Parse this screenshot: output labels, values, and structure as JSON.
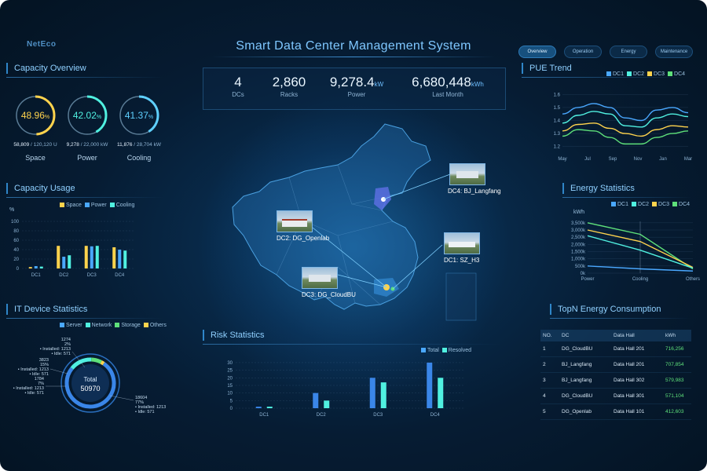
{
  "header": {
    "logo": "NetEco",
    "title": "Smart Data Center Management System",
    "tabs": [
      {
        "label": "Overview",
        "active": true
      },
      {
        "label": "Operation",
        "active": false
      },
      {
        "label": "Energy",
        "active": false
      },
      {
        "label": "Maintenance",
        "active": false
      }
    ]
  },
  "summary": [
    {
      "value": "4",
      "unit": "",
      "label": "DCs"
    },
    {
      "value": "2,860",
      "unit": "",
      "label": "Racks"
    },
    {
      "value": "9,278.4",
      "unit": "kW",
      "label": "Power"
    },
    {
      "value": "6,680,448",
      "unit": "kWh",
      "label": "Last Month"
    }
  ],
  "capacity_overview": {
    "title": "Capacity Overview",
    "gauges": [
      {
        "value": "48.96",
        "unit": "%",
        "used": "58,809",
        "total": "/ 120,120",
        "unit_text": "U",
        "label": "Space",
        "fraction": 0.4896,
        "color": "#ffd34d"
      },
      {
        "value": "42.02",
        "unit": "%",
        "used": "9,278",
        "total": "/ 22,000",
        "unit_text": "kW",
        "label": "Power",
        "fraction": 0.4202,
        "color": "#50f0e0"
      },
      {
        "value": "41.37",
        "unit": "%",
        "used": "11,876",
        "total": "/ 28,704",
        "unit_text": "kW",
        "label": "Cooling",
        "fraction": 0.4137,
        "color": "#5fd0ff"
      }
    ]
  },
  "capacity_usage": {
    "title": "Capacity Usage",
    "y_unit": "%",
    "legend": [
      {
        "name": "Space",
        "color": "#ffd34d"
      },
      {
        "name": "Power",
        "color": "#4aa8ff"
      },
      {
        "name": "Cooling",
        "color": "#50f0e0"
      }
    ]
  },
  "it_device": {
    "title": "IT Device Statistics",
    "legend": [
      {
        "name": "Server",
        "color": "#4aa8ff"
      },
      {
        "name": "Network",
        "color": "#50f0e0"
      },
      {
        "name": "Storage",
        "color": "#5ee07a"
      },
      {
        "name": "Others",
        "color": "#ffd34d"
      }
    ],
    "total_label": "Total",
    "total_value": "50970",
    "callouts": [
      {
        "lines": [
          "1274",
          "2%",
          "• Installed: 1213",
          "• Idle: 571"
        ]
      },
      {
        "lines": [
          "3823",
          "15%",
          "• Installed: 1213",
          "• Idle: 571"
        ]
      },
      {
        "lines": [
          "1784",
          "7%",
          "• Installed: 1213",
          "• Idle: 571"
        ]
      },
      {
        "lines": [
          "18604",
          "77%",
          "• Installed: 1213",
          "• Idle: 571"
        ]
      }
    ]
  },
  "pue": {
    "title": "PUE Trend",
    "legend": [
      {
        "name": "DC1",
        "color": "#4aa8ff"
      },
      {
        "name": "DC2",
        "color": "#50f0e0"
      },
      {
        "name": "DC3",
        "color": "#ffd34d"
      },
      {
        "name": "DC4",
        "color": "#5ee07a"
      }
    ]
  },
  "energy": {
    "title": "Energy Statistics",
    "y_unit": "kWh",
    "legend": [
      {
        "name": "DC1",
        "color": "#4aa8ff"
      },
      {
        "name": "DC2",
        "color": "#50f0e0"
      },
      {
        "name": "DC3",
        "color": "#ffd34d"
      },
      {
        "name": "DC4",
        "color": "#5ee07a"
      }
    ]
  },
  "risk": {
    "title": "Risk Statistics",
    "legend": [
      {
        "name": "Total",
        "color": "#4aa8ff"
      },
      {
        "name": "Resolved",
        "color": "#50f0e0"
      }
    ]
  },
  "map": {
    "sites": [
      {
        "label": "DC4: BJ_Langfang"
      },
      {
        "label": "DC2: DG_Openlab"
      },
      {
        "label": "DC1: SZ_H3"
      },
      {
        "label": "DC3: DG_CloudBU"
      }
    ]
  },
  "topn": {
    "title": "TopN Energy Consumption",
    "headers": [
      "NO.",
      "DC",
      "Data Hall",
      "kWh"
    ],
    "rows": [
      [
        "1",
        "DG_CloudBU",
        "Data Hall 201",
        "716,256"
      ],
      [
        "2",
        "BJ_Langfang",
        "Data Hall 201",
        "707,854"
      ],
      [
        "3",
        "BJ_Langfang",
        "Data Hall 302",
        "579,983"
      ],
      [
        "4",
        "DG_CloudBU",
        "Data Hall 301",
        "571,104"
      ],
      [
        "5",
        "DG_Openlab",
        "Data Hall 101",
        "412,603"
      ]
    ]
  },
  "chart_data": [
    {
      "type": "bar",
      "title": "Capacity Usage",
      "categories": [
        "DC1",
        "DC2",
        "DC3",
        "DC4"
      ],
      "series": [
        {
          "name": "Space",
          "values": [
            3,
            48,
            48,
            45
          ]
        },
        {
          "name": "Power",
          "values": [
            5,
            25,
            47,
            40
          ]
        },
        {
          "name": "Cooling",
          "values": [
            4,
            28,
            48,
            38
          ]
        }
      ],
      "ylabel": "%",
      "yticks": [
        0,
        20,
        40,
        60,
        80,
        100
      ],
      "ylim": [
        0,
        100
      ]
    },
    {
      "type": "line",
      "title": "PUE Trend",
      "x": [
        "May",
        "Jul",
        "Sep",
        "Nov",
        "Jan",
        "Mar"
      ],
      "series": [
        {
          "name": "DC1",
          "values": [
            1.45,
            1.5,
            1.53,
            1.5,
            1.42,
            1.4,
            1.48,
            1.5,
            1.46
          ]
        },
        {
          "name": "DC2",
          "values": [
            1.38,
            1.44,
            1.47,
            1.45,
            1.36,
            1.35,
            1.42,
            1.45,
            1.43
          ]
        },
        {
          "name": "DC3",
          "values": [
            1.32,
            1.37,
            1.38,
            1.34,
            1.3,
            1.28,
            1.33,
            1.36,
            1.35
          ]
        },
        {
          "name": "DC4",
          "values": [
            1.28,
            1.33,
            1.32,
            1.27,
            1.22,
            1.22,
            1.27,
            1.3,
            1.32
          ]
        }
      ],
      "yticks": [
        1.2,
        1.3,
        1.4,
        1.5,
        1.6
      ],
      "ylim": [
        1.15,
        1.62
      ]
    },
    {
      "type": "line",
      "title": "Energy Statistics",
      "x": [
        "Power",
        "Cooling",
        "Others"
      ],
      "series": [
        {
          "name": "DC1",
          "values": [
            3500000,
            2700000,
            300000
          ]
        },
        {
          "name": "DC2",
          "values": [
            3000000,
            2200000,
            400000
          ]
        },
        {
          "name": "DC3",
          "values": [
            2600000,
            1600000,
            350000
          ]
        },
        {
          "name": "DC4",
          "values": [
            500000,
            300000,
            150000
          ]
        }
      ],
      "ylabel": "kWh",
      "ytick_labels": [
        "0k",
        "500k",
        "1,000k",
        "1,500k",
        "2,000k",
        "2,500k",
        "3,000k",
        "3,500k"
      ],
      "yticks": [
        0,
        500000,
        1000000,
        1500000,
        2000000,
        2500000,
        3000000,
        3500000
      ],
      "ylim": [
        0,
        3600000
      ]
    },
    {
      "type": "bar",
      "title": "Risk Statistics",
      "categories": [
        "DC1",
        "DC2",
        "DC3",
        "DC4"
      ],
      "series": [
        {
          "name": "Total",
          "values": [
            1,
            10,
            20,
            30
          ]
        },
        {
          "name": "Resolved",
          "values": [
            1,
            5,
            17,
            20
          ]
        }
      ],
      "yticks": [
        0,
        5,
        10,
        15,
        20,
        25,
        30
      ],
      "ylim": [
        0,
        31
      ]
    },
    {
      "type": "pie",
      "title": "IT Device Statistics",
      "categories": [
        "Server",
        "Network",
        "Storage",
        "Others"
      ],
      "values": [
        77,
        15,
        7,
        2
      ]
    }
  ]
}
